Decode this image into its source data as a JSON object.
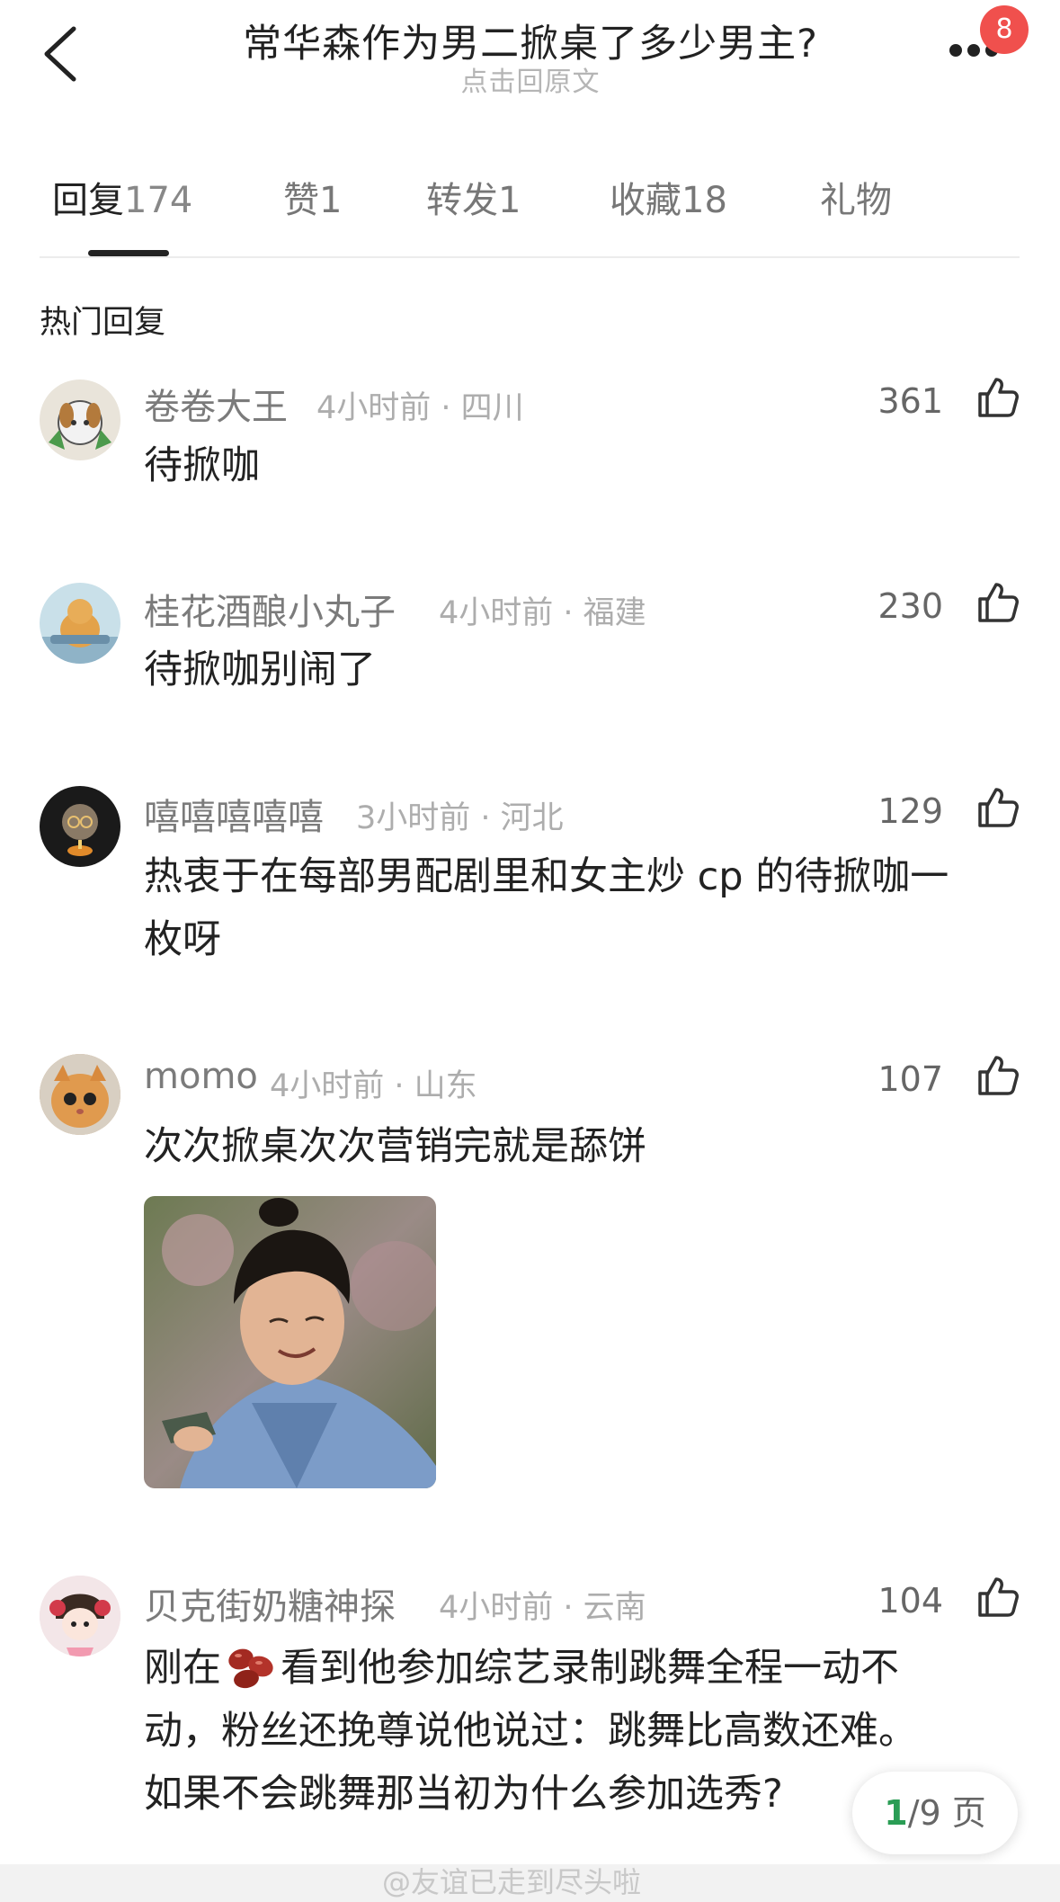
{
  "header": {
    "title": "常华森作为男二掀桌了多少男主?",
    "subtitle": "点击回原文",
    "notification_count": "8"
  },
  "tabs": [
    {
      "label": "回复",
      "count": "174",
      "active": true
    },
    {
      "label": "赞",
      "count": "1",
      "active": false
    },
    {
      "label": "转发",
      "count": "1",
      "active": false
    },
    {
      "label": "收藏",
      "count": "18",
      "active": false
    },
    {
      "label": "礼物",
      "count": "",
      "active": false
    }
  ],
  "section_title": "热门回复",
  "comments": [
    {
      "name": "卷卷大王",
      "meta": "4小时前 · 四川",
      "likes": "361",
      "lines": [
        "待掀咖"
      ]
    },
    {
      "name": "桂花酒酿小丸子",
      "meta": "4小时前 · 福建",
      "likes": "230",
      "lines": [
        "待掀咖别闹了"
      ]
    },
    {
      "name": "嘻嘻嘻嘻嘻",
      "meta": "3小时前 · 河北",
      "likes": "129",
      "lines": [
        "热衷于在每部男配剧里和女主炒 cp 的待掀咖一",
        "枚呀"
      ]
    },
    {
      "name": "momo",
      "meta": "4小时前 · 山东",
      "likes": "107",
      "lines": [
        "次次掀桌次次营销完就是舔饼"
      ]
    },
    {
      "name": "贝克街奶糖神探",
      "meta": "4小时前 · 云南",
      "likes": "104",
      "line1_pre": "刚在",
      "line1_post": "看到他参加综艺录制跳舞全程一动不",
      "lines": [
        "动，粉丝还挽尊说他说过：跳舞比高数还难。",
        "如果不会跳舞那当初为什么参加选秀?"
      ]
    }
  ],
  "pager": {
    "current": "1",
    "rest": "/9 页"
  },
  "watermark": "@友谊已走到尽头啦",
  "colors": {
    "badge": "#f0504d",
    "pager_current": "#2a9d55"
  }
}
